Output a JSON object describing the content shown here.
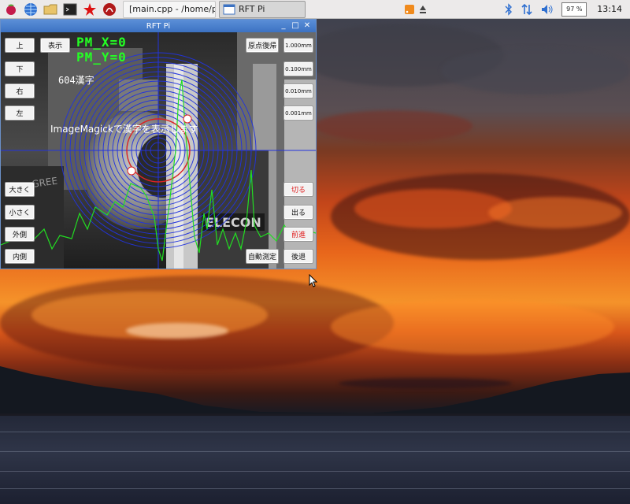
{
  "taskbar": {
    "tasks": [
      {
        "label": "[main.cpp - /home/pi..."
      },
      {
        "label": "RFT Pi"
      }
    ],
    "cpu": "97 %",
    "clock": "13:14"
  },
  "window": {
    "title": "RFT Pi",
    "controls": {
      "minimize": "_",
      "maximize": "□",
      "close": "✕"
    },
    "overlay": {
      "pm_x": "PM_X=0",
      "pm_y": "PM_Y=0",
      "kanji_label": "604漢字",
      "message": "ImageMagickで漢字を表示します"
    },
    "buttons": {
      "up": "上",
      "down": "下",
      "right": "右",
      "left": "左",
      "display": "表示",
      "origin_return": "原点復帰",
      "step_1000": "1.000mm",
      "step_0100": "0.100mm",
      "step_0010": "0.010mm",
      "step_0001": "0.001mm",
      "bigger": "大きく",
      "smaller": "小さく",
      "outside": "外側",
      "inside": "内側",
      "cut": "切る",
      "exit": "出る",
      "forward": "前進",
      "backward": "後退",
      "auto_measure": "自動測定"
    }
  },
  "colors": {
    "pm_text": "#24ff24",
    "rings": "#2233dd",
    "profile": "#22dd22",
    "red_button_text": "#e02020",
    "title_bar": "#3c72c2"
  }
}
